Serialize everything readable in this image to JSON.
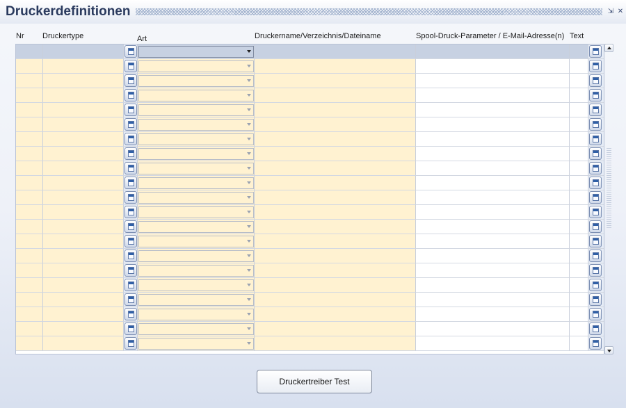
{
  "window": {
    "title": "Druckerdefinitionen",
    "minimize_icon": "minimize-icon",
    "close_icon": "close-icon"
  },
  "columns": {
    "nr": "Nr",
    "druckertype": "Druckertype",
    "art": "Art",
    "druckername": "Druckername/Verzeichnis/Dateiname",
    "spool": "Spool-Druck-Parameter / E-Mail-Adresse(n)",
    "text": "Text"
  },
  "rows": [
    {
      "nr": "",
      "druckertype": "",
      "art": "",
      "druckername": "",
      "spool": "",
      "text": "",
      "selected": true
    },
    {
      "nr": "",
      "druckertype": "",
      "art": "",
      "druckername": "",
      "spool": "",
      "text": ""
    },
    {
      "nr": "",
      "druckertype": "",
      "art": "",
      "druckername": "",
      "spool": "",
      "text": ""
    },
    {
      "nr": "",
      "druckertype": "",
      "art": "",
      "druckername": "",
      "spool": "",
      "text": ""
    },
    {
      "nr": "",
      "druckertype": "",
      "art": "",
      "druckername": "",
      "spool": "",
      "text": ""
    },
    {
      "nr": "",
      "druckertype": "",
      "art": "",
      "druckername": "",
      "spool": "",
      "text": ""
    },
    {
      "nr": "",
      "druckertype": "",
      "art": "",
      "druckername": "",
      "spool": "",
      "text": ""
    },
    {
      "nr": "",
      "druckertype": "",
      "art": "",
      "druckername": "",
      "spool": "",
      "text": ""
    },
    {
      "nr": "",
      "druckertype": "",
      "art": "",
      "druckername": "",
      "spool": "",
      "text": ""
    },
    {
      "nr": "",
      "druckertype": "",
      "art": "",
      "druckername": "",
      "spool": "",
      "text": ""
    },
    {
      "nr": "",
      "druckertype": "",
      "art": "",
      "druckername": "",
      "spool": "",
      "text": ""
    },
    {
      "nr": "",
      "druckertype": "",
      "art": "",
      "druckername": "",
      "spool": "",
      "text": ""
    },
    {
      "nr": "",
      "druckertype": "",
      "art": "",
      "druckername": "",
      "spool": "",
      "text": ""
    },
    {
      "nr": "",
      "druckertype": "",
      "art": "",
      "druckername": "",
      "spool": "",
      "text": ""
    },
    {
      "nr": "",
      "druckertype": "",
      "art": "",
      "druckername": "",
      "spool": "",
      "text": ""
    },
    {
      "nr": "",
      "druckertype": "",
      "art": "",
      "druckername": "",
      "spool": "",
      "text": ""
    },
    {
      "nr": "",
      "druckertype": "",
      "art": "",
      "druckername": "",
      "spool": "",
      "text": ""
    },
    {
      "nr": "",
      "druckertype": "",
      "art": "",
      "druckername": "",
      "spool": "",
      "text": ""
    },
    {
      "nr": "",
      "druckertype": "",
      "art": "",
      "druckername": "",
      "spool": "",
      "text": ""
    },
    {
      "nr": "",
      "druckertype": "",
      "art": "",
      "druckername": "",
      "spool": "",
      "text": ""
    },
    {
      "nr": "",
      "druckertype": "",
      "art": "",
      "druckername": "",
      "spool": "",
      "text": ""
    }
  ],
  "buttons": {
    "druckertreiber_test": "Druckertreiber Test"
  },
  "colors": {
    "editable_cell": "#fff2d1",
    "selected_row": "#c7d1e2",
    "title_text": "#2a3a5e"
  }
}
